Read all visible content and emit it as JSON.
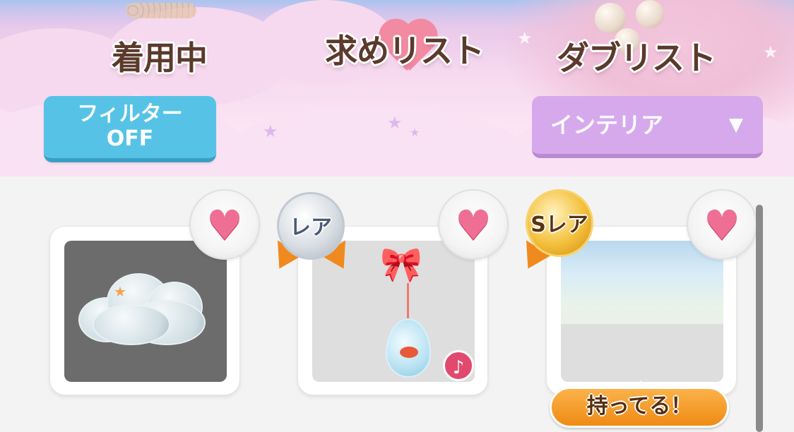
{
  "tabs": {
    "wearing": "着用中",
    "wishlist": "求めリスト",
    "duplicates": "ダブリスト"
  },
  "filter": {
    "line1": "フィルター",
    "line2": "OFF"
  },
  "category_select": {
    "selected": "インテリア",
    "chevron": "▼"
  },
  "items": [
    {
      "rarity": "",
      "thumbnail": "cloud",
      "heart": "♥"
    },
    {
      "rarity": "レア",
      "thumbnail": "ribbon-drop",
      "heart": "♥",
      "music": "♪"
    },
    {
      "rarity": "Sレア",
      "thumbnail": "winged-garden",
      "heart": "♥",
      "owned_label": "持ってる！"
    }
  ],
  "colors": {
    "filter_button": "#56c3e6",
    "category_select": "#d6a9ec",
    "heart": "#ef6f94",
    "owned_badge": "#ef8b14"
  }
}
